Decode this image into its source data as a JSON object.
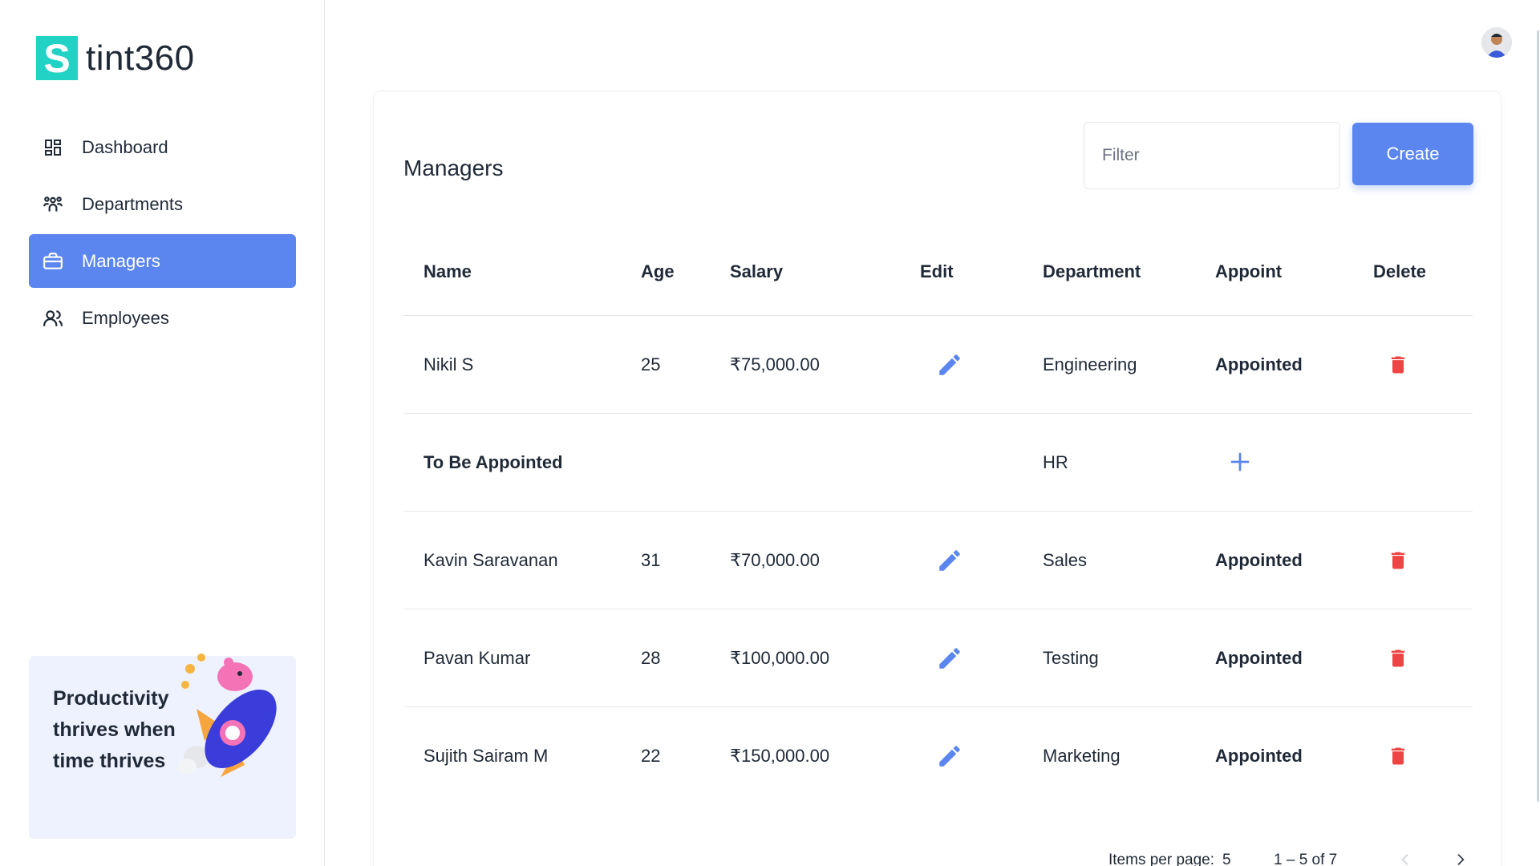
{
  "brand": {
    "mark": "S",
    "name": "tint360"
  },
  "nav": {
    "items": [
      {
        "label": "Dashboard",
        "icon": "dashboard-icon"
      },
      {
        "label": "Departments",
        "icon": "departments-icon"
      },
      {
        "label": "Managers",
        "icon": "briefcase-icon",
        "active": true
      },
      {
        "label": "Employees",
        "icon": "users-icon"
      }
    ]
  },
  "promo": {
    "text": "Productivity thrives when time thrives"
  },
  "card": {
    "title": "Managers",
    "filter_placeholder": "Filter",
    "create_label": "Create"
  },
  "table": {
    "headers": {
      "name": "Name",
      "age": "Age",
      "salary": "Salary",
      "edit": "Edit",
      "department": "Department",
      "appoint": "Appoint",
      "delete": "Delete"
    },
    "rows": [
      {
        "name": "Nikil S",
        "age": "25",
        "salary": "₹75,000.00",
        "department": "Engineering",
        "appoint": "Appointed"
      },
      {
        "name": "To Be Appointed",
        "department": "HR"
      },
      {
        "name": "Kavin Saravanan",
        "age": "31",
        "salary": "₹70,000.00",
        "department": "Sales",
        "appoint": "Appointed"
      },
      {
        "name": "Pavan Kumar",
        "age": "28",
        "salary": "₹100,000.00",
        "department": "Testing",
        "appoint": "Appointed"
      },
      {
        "name": "Sujith Sairam M",
        "age": "22",
        "salary": "₹150,000.00",
        "department": "Marketing",
        "appoint": "Appointed"
      }
    ]
  },
  "pagination": {
    "items_per_page_label": "Items per page:",
    "items_per_page": "5",
    "range": "1 – 5 of 7"
  },
  "colors": {
    "accent": "#5b86ef",
    "brand": "#22d3c5",
    "danger": "#ef4444"
  }
}
